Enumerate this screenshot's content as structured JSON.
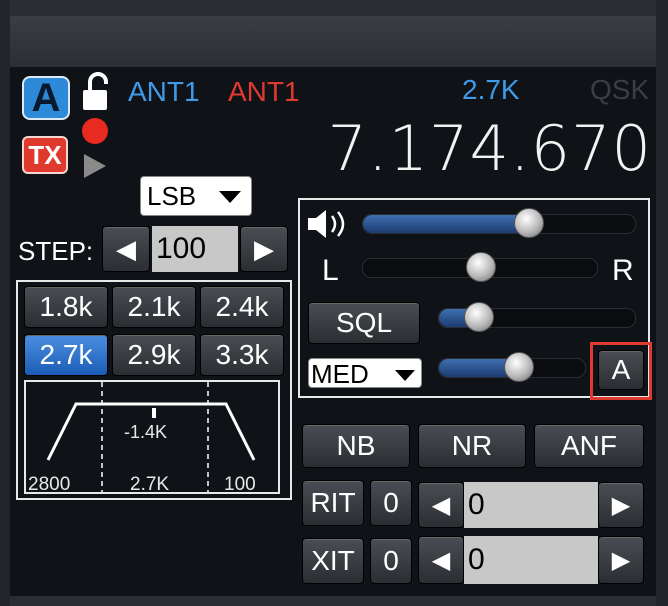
{
  "vfo": {
    "slice_letter": "A",
    "tx_label": "TX",
    "rx_antenna": "ANT1",
    "tx_antenna": "ANT1",
    "filter_width": "2.7K",
    "qsk": "QSK",
    "frequency": "7.174.670"
  },
  "mode": {
    "selected": "LSB"
  },
  "step": {
    "label": "STEP:",
    "value": "100",
    "left_arrow": "◀",
    "right_arrow": "▶"
  },
  "filters": {
    "buttons": [
      "1.8k",
      "2.1k",
      "2.4k",
      "2.7k",
      "2.9k",
      "3.3k"
    ],
    "selected_index": 3,
    "graph": {
      "center_offset": "-1.4K",
      "low": "2800",
      "width": "2.7K",
      "high": "100"
    }
  },
  "audio": {
    "volume_level": 0.62,
    "pan_level": 0.5,
    "pan_left": "L",
    "pan_right": "R",
    "sql_label": "SQL",
    "sql_level": 0.15,
    "agc_mode": "MED",
    "agc_level": 0.55,
    "agc_auto_label": "A",
    "accent_red": "#e03a2f"
  },
  "dsp": {
    "nb": "NB",
    "nr": "NR",
    "anf": "ANF"
  },
  "rit": {
    "label": "RIT",
    "toggle": "0",
    "value": "0",
    "left_arrow": "◀",
    "right_arrow": "▶"
  },
  "xit": {
    "label": "XIT",
    "toggle": "0",
    "value": "0",
    "left_arrow": "◀",
    "right_arrow": "▶"
  }
}
